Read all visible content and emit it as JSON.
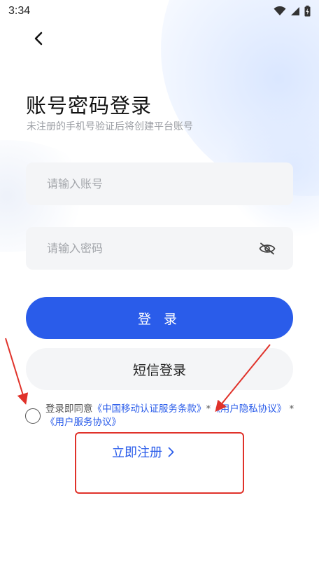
{
  "status_bar": {
    "time": "3:34"
  },
  "login_page": {
    "title": "账号密码登录",
    "subtitle": "未注册的手机号验证后将创建平台账号",
    "account_placeholder": "请输入账号",
    "password_placeholder": "请输入密码",
    "login_button": "登 录",
    "sms_login_button": "短信登录",
    "agreement": {
      "prefix": "登录即同意",
      "link1": "《中国移动认证服务条款》",
      "sep1": "*",
      "link2": "《用户隐私协议》",
      "sep2": "*",
      "link3": "《用户服务协议》"
    },
    "register_link": "立即注册"
  },
  "colors": {
    "accent": "#2a5cea",
    "annotation": "#e0322a"
  }
}
